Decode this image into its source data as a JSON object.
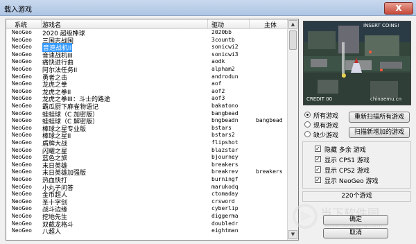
{
  "window": {
    "title": "载入游戏",
    "close_label": "X"
  },
  "columns": {
    "system": "系统",
    "name": "游戏名",
    "driver": "驱动",
    "parent": "主体"
  },
  "rows": [
    {
      "system": "NeoGeo",
      "name": "2020 超级棒球",
      "driver": "2020bb",
      "parent": ""
    },
    {
      "system": "NeoGeo",
      "name": "三国志战国",
      "driver": "3countb",
      "parent": ""
    },
    {
      "system": "NeoGeo",
      "name": "音速战机II",
      "driver": "sonicwi2",
      "parent": "",
      "selected": true
    },
    {
      "system": "NeoGeo",
      "name": "音速战机III",
      "driver": "sonicwi3",
      "parent": ""
    },
    {
      "system": "NeoGeo",
      "name": "痛快进行曲",
      "driver": "aodk",
      "parent": ""
    },
    {
      "system": "NeoGeo",
      "name": "阿尔法任务II",
      "driver": "alpham2",
      "parent": ""
    },
    {
      "system": "NeoGeo",
      "name": "勇者之击",
      "driver": "androdun",
      "parent": ""
    },
    {
      "system": "NeoGeo",
      "name": "龙虎之拳",
      "driver": "aof",
      "parent": ""
    },
    {
      "system": "NeoGeo",
      "name": "龙虎之拳II",
      "driver": "aof2",
      "parent": ""
    },
    {
      "system": "NeoGeo",
      "name": "龙虎之拳III：斗士的路途",
      "driver": "aof3",
      "parent": ""
    },
    {
      "system": "NeoGeo",
      "name": "霸瓜厨下麻雀物语记",
      "driver": "bakatono",
      "parent": ""
    },
    {
      "system": "NeoGeo",
      "name": "蛙蛙球（C 加密版）",
      "driver": "bangbead",
      "parent": ""
    },
    {
      "system": "NeoGeo",
      "name": "蛙蛙球（C 解密版）",
      "driver": "bngbeadn",
      "parent": "bangbead"
    },
    {
      "system": "NeoGeo",
      "name": "棒球之星专业版",
      "driver": "bstars",
      "parent": ""
    },
    {
      "system": "NeoGeo",
      "name": "棒球之星II",
      "driver": "bstars2",
      "parent": ""
    },
    {
      "system": "NeoGeo",
      "name": "盾牌大战",
      "driver": "flipshot",
      "parent": ""
    },
    {
      "system": "NeoGeo",
      "name": "闪耀之星",
      "driver": "blazstar",
      "parent": ""
    },
    {
      "system": "NeoGeo",
      "name": "蓝色之旅",
      "driver": "bjourney",
      "parent": ""
    },
    {
      "system": "NeoGeo",
      "name": "末日英雄",
      "driver": "breakers",
      "parent": ""
    },
    {
      "system": "NeoGeo",
      "name": "末日英雄加强版",
      "driver": "breakrev",
      "parent": "breakers"
    },
    {
      "system": "NeoGeo",
      "name": "热血快打",
      "driver": "burningf",
      "parent": ""
    },
    {
      "system": "NeoGeo",
      "name": "小丸子问答",
      "driver": "marukodq",
      "parent": ""
    },
    {
      "system": "NeoGeo",
      "name": "金币超人",
      "driver": "ctomaday",
      "parent": ""
    },
    {
      "system": "NeoGeo",
      "name": "圣十字剑",
      "driver": "crsword",
      "parent": ""
    },
    {
      "system": "NeoGeo",
      "name": "战斗边缘",
      "driver": "cyberlip",
      "parent": ""
    },
    {
      "system": "NeoGeo",
      "name": "挖地先生",
      "driver": "diggerma",
      "parent": ""
    },
    {
      "system": "NeoGeo",
      "name": "双截龙格斗",
      "driver": "doubledr",
      "parent": ""
    },
    {
      "system": "NeoGeo",
      "name": "八超人",
      "driver": "eightman",
      "parent": ""
    }
  ],
  "filter": {
    "options": [
      {
        "label": "所有游戏",
        "checked": true
      },
      {
        "label": "现有游戏",
        "checked": false
      },
      {
        "label": "缺少游戏",
        "checked": false
      }
    ],
    "rescan_all_label": "重新扫描所有游戏",
    "scan_new_label": "扫描新增加的游戏"
  },
  "display": [
    {
      "label": "隐藏 多余 游戏",
      "checked": true
    },
    {
      "label": "显示 CPS1 游戏",
      "checked": true
    },
    {
      "label": "显示 CPS2 游戏",
      "checked": true
    },
    {
      "label": "显示 NeoGeo 游戏",
      "checked": true
    }
  ],
  "count_label": "220个游戏",
  "ok_label": "确定",
  "cancel_label": "取消",
  "preview": {
    "hud_text": "INSERT COINS!",
    "credit_text": "CREDIT 00",
    "site_text": "chinaemu.cn"
  },
  "watermark": {
    "name": "当下软件园",
    "url": "www.downxia.com"
  },
  "colors": {
    "selection": "#3399ff",
    "titlebar": "#b9cde6",
    "close_button": "#c74a38"
  }
}
